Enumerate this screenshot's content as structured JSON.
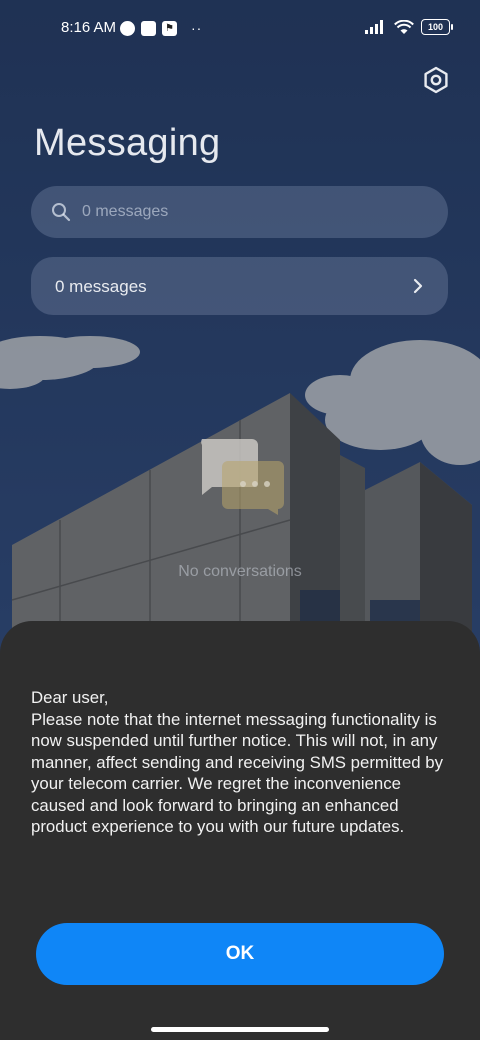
{
  "status_bar": {
    "time": "8:16 AM",
    "notif_icons": [
      "speedometer-icon",
      "app-square-icon",
      "flag-app-icon"
    ],
    "more": "··",
    "battery": "100"
  },
  "header": {
    "title": "Messaging",
    "settings_icon": "gear-icon"
  },
  "search": {
    "placeholder": "0 messages"
  },
  "folder_row": {
    "label": "0 messages"
  },
  "empty_state": {
    "text": "No conversations"
  },
  "dialog": {
    "greeting": "Dear user,",
    "body": "Please note that the internet messaging functionality is now suspended until further notice. This will not, in any manner, affect sending and receiving SMS permitted by your telecom carrier. We regret the inconvenience caused and look forward to bringing an enhanced product experience to you with our future updates.",
    "ok_label": "OK"
  },
  "colors": {
    "accent": "#0f86f7",
    "sheet_bg": "#2e2e2e"
  }
}
